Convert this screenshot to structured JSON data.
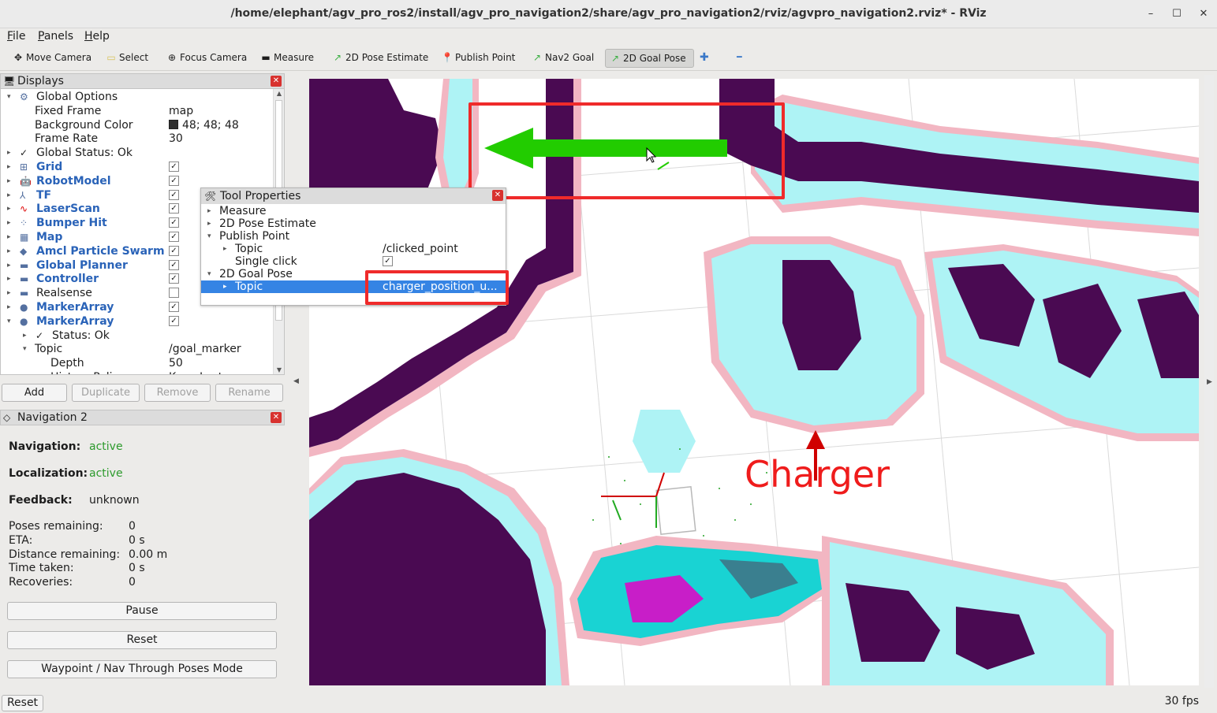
{
  "window": {
    "title": "/home/elephant/agv_pro_ros2/install/agv_pro_navigation2/share/agv_pro_navigation2/rviz/agvpro_navigation2.rviz* - RViz",
    "minimize": "–",
    "maximize": "☐",
    "close": "✕"
  },
  "menu": [
    "File",
    "Panels",
    "Help"
  ],
  "toolbar": {
    "tools": [
      {
        "label": "Move Camera",
        "icon": "move-camera-icon",
        "glyph": "✥"
      },
      {
        "label": "Select",
        "icon": "select-icon",
        "glyph": "▭"
      },
      {
        "label": "Focus Camera",
        "icon": "focus-camera-icon",
        "glyph": "⊕"
      },
      {
        "label": "Measure",
        "icon": "measure-icon",
        "glyph": "▬"
      },
      {
        "label": "2D Pose Estimate",
        "icon": "pose-estimate-icon",
        "glyph": "↗"
      },
      {
        "label": "Publish Point",
        "icon": "publish-point-icon",
        "glyph": "📍"
      },
      {
        "label": "Nav2 Goal",
        "icon": "nav2-goal-icon",
        "glyph": "↗"
      },
      {
        "label": "2D Goal Pose",
        "icon": "goal-pose-icon",
        "glyph": "↗"
      }
    ],
    "add_glyph": "✚",
    "remove_glyph": "━"
  },
  "displays": {
    "title": "Displays",
    "rows": [
      {
        "label": "Global Options",
        "arrow": "▾",
        "icon": "⚙",
        "blue": false
      },
      {
        "label": "Fixed Frame",
        "value": "map"
      },
      {
        "label": "Background Color",
        "value": "48; 48; 48",
        "swatch": true
      },
      {
        "label": "Frame Rate",
        "value": "30"
      },
      {
        "label": "Global Status: Ok",
        "arrow": "▸",
        "icon": "✓"
      },
      {
        "label": "Grid",
        "arrow": "▸",
        "icon": "⊞",
        "blue": true,
        "checked": true
      },
      {
        "label": "RobotModel",
        "arrow": "▸",
        "icon": "🤖",
        "blue": true,
        "checked": true
      },
      {
        "label": "TF",
        "arrow": "▸",
        "icon": "⅄",
        "blue": true,
        "checked": true
      },
      {
        "label": "LaserScan",
        "arrow": "▸",
        "icon": "∿",
        "blue": true,
        "checked": true
      },
      {
        "label": "Bumper Hit",
        "arrow": "▸",
        "icon": "⁘",
        "blue": true,
        "checked": true
      },
      {
        "label": "Map",
        "arrow": "▸",
        "icon": "▦",
        "blue": true,
        "checked": true
      },
      {
        "label": "Amcl Particle Swarm",
        "arrow": "▸",
        "icon": "◆",
        "blue": true,
        "checked": true
      },
      {
        "label": "Global Planner",
        "arrow": "▸",
        "icon": "▬",
        "blue": true,
        "checked": true
      },
      {
        "label": "Controller",
        "arrow": "▸",
        "icon": "▬",
        "blue": true,
        "checked": true
      },
      {
        "label": "Realsense",
        "arrow": "▸",
        "icon": "▬",
        "blue": false,
        "checked": false
      },
      {
        "label": "MarkerArray",
        "arrow": "▸",
        "icon": "●",
        "blue": true,
        "checked": true
      },
      {
        "label": "MarkerArray",
        "arrow": "▾",
        "icon": "●",
        "blue": true,
        "checked": true
      },
      {
        "label": "Status: Ok",
        "arrow": "▸",
        "icon": "✓"
      },
      {
        "label": "Topic",
        "arrow": "▾",
        "value": "/goal_marker"
      },
      {
        "label": "Depth",
        "value": "50"
      },
      {
        "label": "History Policy",
        "value": "Keep Last"
      }
    ],
    "buttons": [
      "Add",
      "Duplicate",
      "Remove",
      "Rename"
    ]
  },
  "tool_properties": {
    "title": "Tool Properties",
    "rows": [
      {
        "label": "Measure",
        "arrow": "▸"
      },
      {
        "label": "2D Pose Estimate",
        "arrow": "▸"
      },
      {
        "label": "Publish Point",
        "arrow": "▾"
      },
      {
        "label": "Topic",
        "arrow": "▸",
        "value": "/clicked_point"
      },
      {
        "label": "Single click",
        "checked": true
      },
      {
        "label": "2D Goal Pose",
        "arrow": "▾"
      },
      {
        "label": "Topic",
        "arrow": "▸",
        "value": "charger_position_u...",
        "selected": true
      }
    ]
  },
  "navigation": {
    "title": "Navigation 2",
    "status": [
      {
        "label": "Navigation:",
        "value": "active"
      },
      {
        "label": "Localization:",
        "value": "active"
      },
      {
        "label": "Feedback:",
        "value": "unknown"
      }
    ],
    "metrics": [
      {
        "label": "Poses remaining:",
        "value": "0"
      },
      {
        "label": "ETA:",
        "value": "0 s"
      },
      {
        "label": "Distance remaining:",
        "value": "0.00 m"
      },
      {
        "label": "Time taken:",
        "value": "0 s"
      },
      {
        "label": "Recoveries:",
        "value": "0"
      }
    ],
    "buttons": [
      "Pause",
      "Reset",
      "Waypoint / Nav Through Poses Mode"
    ]
  },
  "viewport": {
    "marker_label": "Charger",
    "colors": {
      "obstacle": "#4a0a52",
      "inflation": "#aef3f5",
      "border": "#f2b6c2",
      "arrow": "#22cc00",
      "highlight": "#ef2a2a"
    }
  },
  "statusbar": {
    "reset": "Reset",
    "fps": "30 fps"
  }
}
